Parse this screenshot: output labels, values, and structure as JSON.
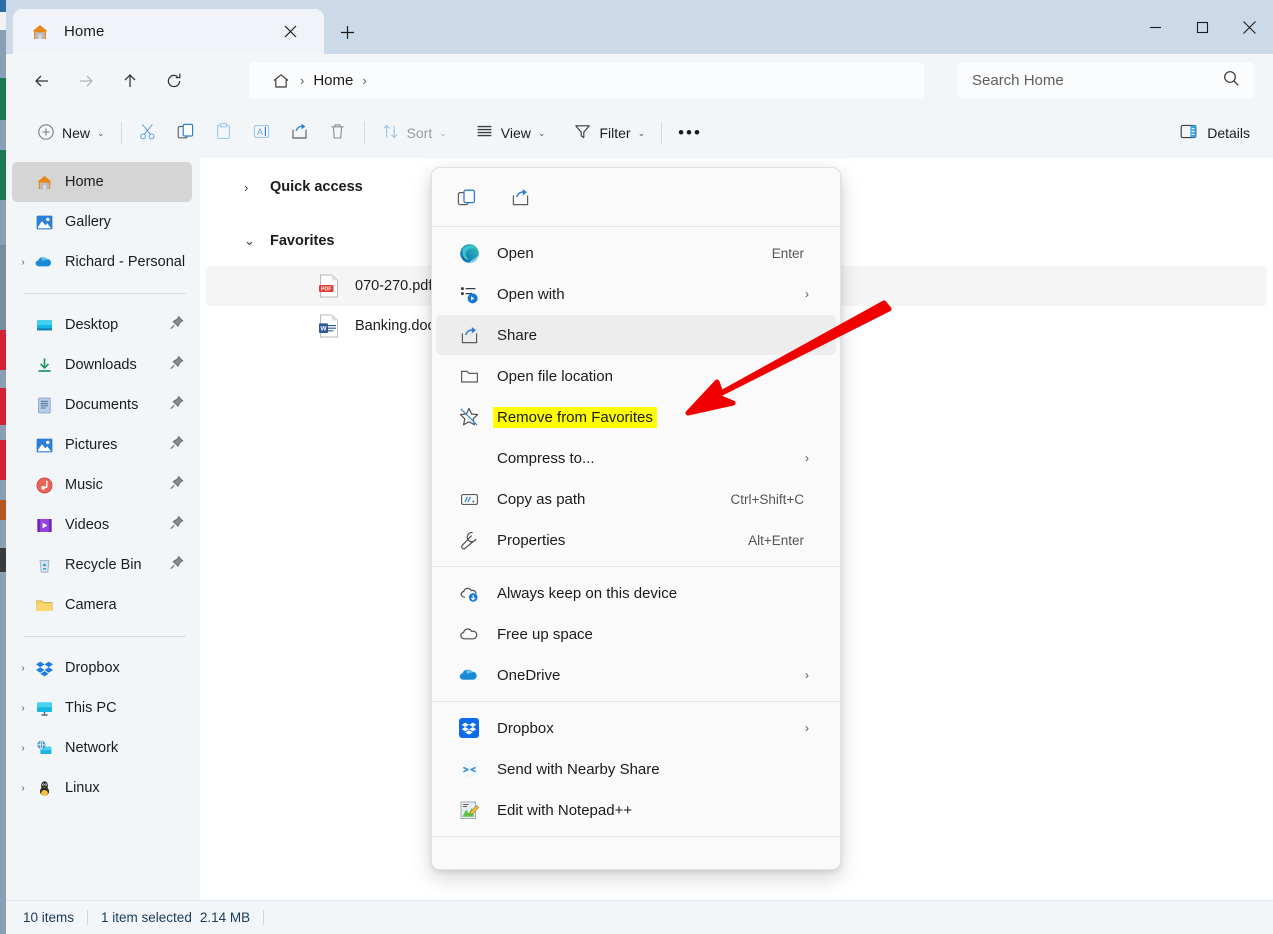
{
  "window": {
    "tab_title": "Home",
    "tab_icon": "home-icon",
    "new_tab_icon": "plus-icon",
    "close_tab_icon": "close-icon",
    "minimize_label": "—",
    "maximize_label": "□",
    "close_label": "✕"
  },
  "nav": {
    "back_icon": "arrow-left-icon",
    "forward_icon": "arrow-right-icon",
    "up_icon": "arrow-up-icon",
    "refresh_icon": "refresh-icon",
    "breadcrumb_home_icon": "home-outline-icon",
    "breadcrumb_sep1": "›",
    "breadcrumb_text": "Home",
    "breadcrumb_sep2": "›"
  },
  "search": {
    "placeholder": "Search Home",
    "value": "",
    "icon": "search-icon"
  },
  "toolbar": {
    "new_label": "New",
    "new_icon": "plus-circle-icon",
    "cut_icon": "scissors-icon",
    "copy_icon": "copy-icon",
    "paste_icon": "clipboard-icon",
    "rename_icon": "rename-icon",
    "share_icon": "share-icon",
    "delete_icon": "trash-icon",
    "sort_label": "Sort",
    "sort_icon": "sort-icon",
    "view_label": "View",
    "view_icon": "list-icon",
    "filter_label": "Filter",
    "filter_icon": "funnel-icon",
    "more_label": "•••",
    "details_label": "Details",
    "details_icon": "details-pane-icon",
    "chevron": "⌄"
  },
  "sidebar": {
    "items": [
      {
        "label": "Home",
        "icon": "home-icon",
        "selected": true,
        "chevron": false,
        "pinned": false
      },
      {
        "label": "Gallery",
        "icon": "gallery-icon",
        "selected": false,
        "chevron": false,
        "pinned": false
      },
      {
        "label": "Richard - Personal",
        "icon": "onedrive-icon",
        "selected": false,
        "chevron": true,
        "pinned": false
      },
      {
        "divider": true
      },
      {
        "label": "Desktop",
        "icon": "desktop-icon",
        "selected": false,
        "chevron": false,
        "pinned": true
      },
      {
        "label": "Downloads",
        "icon": "downloads-icon",
        "selected": false,
        "chevron": false,
        "pinned": true
      },
      {
        "label": "Documents",
        "icon": "documents-icon",
        "selected": false,
        "chevron": false,
        "pinned": true
      },
      {
        "label": "Pictures",
        "icon": "pictures-icon",
        "selected": false,
        "chevron": false,
        "pinned": true
      },
      {
        "label": "Music",
        "icon": "music-icon",
        "selected": false,
        "chevron": false,
        "pinned": true
      },
      {
        "label": "Videos",
        "icon": "videos-icon",
        "selected": false,
        "chevron": false,
        "pinned": true
      },
      {
        "label": "Recycle Bin",
        "icon": "recycle-bin-icon",
        "selected": false,
        "chevron": false,
        "pinned": true
      },
      {
        "label": "Camera",
        "icon": "folder-icon",
        "selected": false,
        "chevron": false,
        "pinned": false
      },
      {
        "divider": true
      },
      {
        "label": "Dropbox",
        "icon": "dropbox-icon",
        "selected": false,
        "chevron": true,
        "pinned": false
      },
      {
        "label": "This PC",
        "icon": "this-pc-icon",
        "selected": false,
        "chevron": true,
        "pinned": false
      },
      {
        "label": "Network",
        "icon": "network-icon",
        "selected": false,
        "chevron": true,
        "pinned": false
      },
      {
        "label": "Linux",
        "icon": "linux-icon",
        "selected": false,
        "chevron": true,
        "pinned": false
      }
    ]
  },
  "content": {
    "groups": [
      {
        "label": "Quick access",
        "expanded": false,
        "chevron": "›",
        "files": []
      },
      {
        "label": "Favorites",
        "expanded": true,
        "chevron": "⌄",
        "files": [
          {
            "name": "070-270.pdf",
            "icon": "pdf-file-icon",
            "selected": true
          },
          {
            "name": "Banking.docx",
            "icon": "word-file-icon",
            "selected": false
          }
        ]
      }
    ]
  },
  "statusbar": {
    "item_count": "10 items",
    "selection": "1 item selected",
    "size": "2.14 MB"
  },
  "context_menu": {
    "icon_row": [
      {
        "name": "copy-icon",
        "label": "Copy"
      },
      {
        "name": "share-icon",
        "label": "Share"
      }
    ],
    "sections": [
      {
        "items": [
          {
            "label": "Open",
            "icon": "edge-icon",
            "accel": "Enter",
            "submenu": false,
            "hover": false,
            "highlight": false
          },
          {
            "label": "Open with",
            "icon": "open-with-icon",
            "accel": "",
            "submenu": true,
            "hover": false,
            "highlight": false
          },
          {
            "label": "Share",
            "icon": "share-icon",
            "accel": "",
            "submenu": false,
            "hover": true,
            "highlight": false
          },
          {
            "label": "Open file location",
            "icon": "folder-outline-icon",
            "accel": "",
            "submenu": false,
            "hover": false,
            "highlight": false
          },
          {
            "label": "Remove from Favorites",
            "icon": "unpin-star-icon",
            "accel": "",
            "submenu": false,
            "hover": false,
            "highlight": true
          },
          {
            "label": "Compress to...",
            "icon": "",
            "accel": "",
            "submenu": true,
            "hover": false,
            "highlight": false
          },
          {
            "label": "Copy as path",
            "icon": "copy-path-icon",
            "accel": "Ctrl+Shift+C",
            "submenu": false,
            "hover": false,
            "highlight": false
          },
          {
            "label": "Properties",
            "icon": "wrench-icon",
            "accel": "Alt+Enter",
            "submenu": false,
            "hover": false,
            "highlight": false
          }
        ]
      },
      {
        "items": [
          {
            "label": "Always keep on this device",
            "icon": "cloud-download-icon",
            "accel": "",
            "submenu": false,
            "hover": false,
            "highlight": false
          },
          {
            "label": "Free up space",
            "icon": "cloud-outline-icon",
            "accel": "",
            "submenu": false,
            "hover": false,
            "highlight": false
          },
          {
            "label": "OneDrive",
            "icon": "onedrive-icon",
            "accel": "",
            "submenu": true,
            "hover": false,
            "highlight": false
          }
        ]
      },
      {
        "items": [
          {
            "label": "Dropbox",
            "icon": "dropbox-icon",
            "accel": "",
            "submenu": true,
            "hover": false,
            "highlight": false
          },
          {
            "label": "Send with Nearby Share",
            "icon": "nearby-share-icon",
            "accel": "",
            "submenu": false,
            "hover": false,
            "highlight": false
          },
          {
            "label": "Edit with Notepad++",
            "icon": "notepadpp-icon",
            "accel": "",
            "submenu": false,
            "hover": false,
            "highlight": false
          }
        ]
      }
    ],
    "submenu_chevron": "›"
  },
  "annotation": {
    "arrow_color": "#f00000",
    "highlight_color": "#ffff00",
    "arrow_name": "red-pointer-arrow"
  }
}
